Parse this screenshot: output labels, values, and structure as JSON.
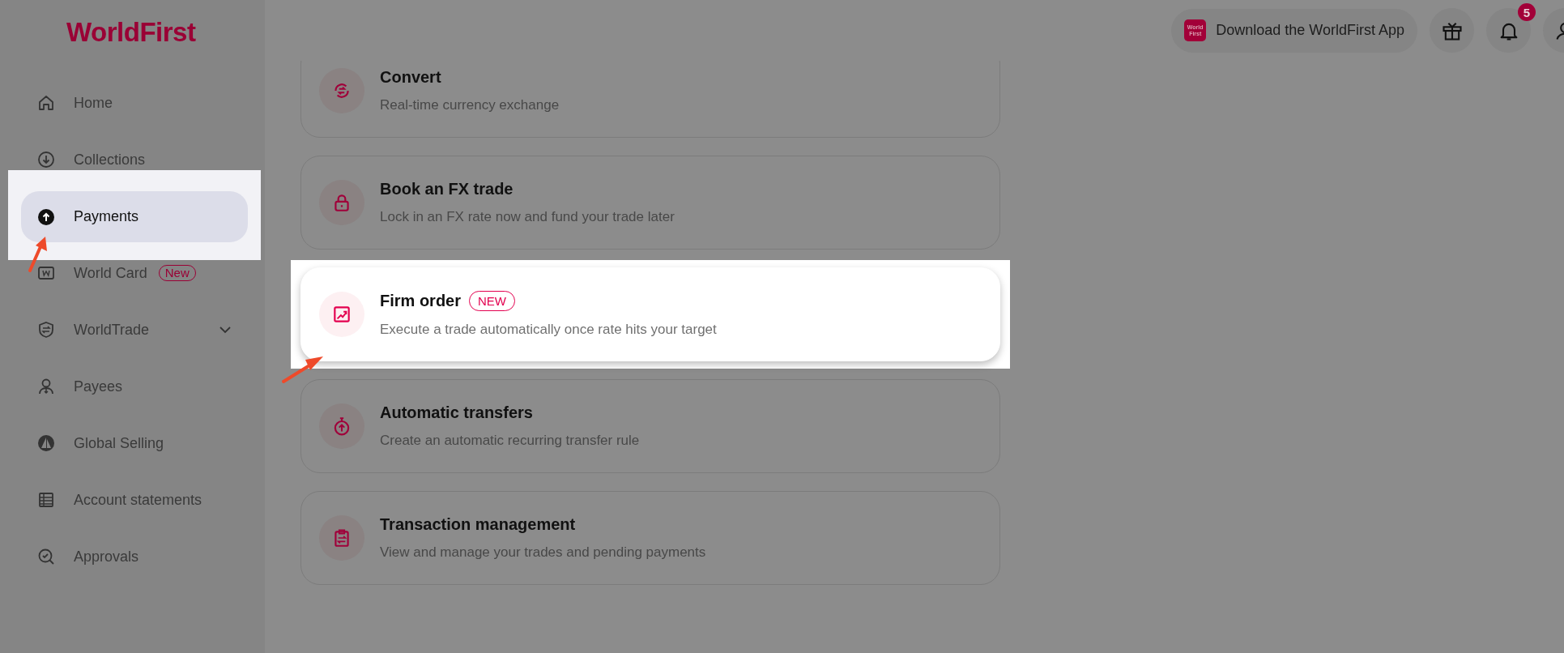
{
  "logo": {
    "text": "WorldFirst"
  },
  "sidebar": {
    "items": [
      {
        "label": "Home",
        "selected": false,
        "highlighted": false
      },
      {
        "label": "Collections",
        "selected": false,
        "highlighted": false
      },
      {
        "label": "Payments",
        "selected": true,
        "highlighted": true
      },
      {
        "label": "World Card",
        "selected": false,
        "highlighted": false,
        "badge": "New"
      },
      {
        "label": "WorldTrade",
        "selected": false,
        "highlighted": false,
        "expanded": false
      },
      {
        "label": "Payees",
        "selected": false,
        "highlighted": false
      },
      {
        "label": "Global Selling",
        "selected": false,
        "highlighted": false
      },
      {
        "label": "Account statements",
        "selected": false,
        "highlighted": false
      },
      {
        "label": "Approvals",
        "selected": false,
        "highlighted": false
      }
    ]
  },
  "header": {
    "app_button": {
      "label": "Download the WorldFirst App",
      "icon_text": "World First"
    },
    "notification_count": "5"
  },
  "cards": [
    {
      "title": "Convert",
      "description": "Real-time currency exchange",
      "highlighted": false
    },
    {
      "title": "Book an FX trade",
      "description": "Lock in an FX rate now and fund your trade later",
      "highlighted": false
    },
    {
      "title": "Firm order",
      "description": "Execute a trade automatically once rate hits your target",
      "highlighted": true,
      "badge": "NEW"
    },
    {
      "title": "Automatic transfers",
      "description": "Create an automatic recurring transfer rule",
      "highlighted": false
    },
    {
      "title": "Transaction management",
      "description": "View and manage your trades and pending payments",
      "highlighted": false
    }
  ]
}
